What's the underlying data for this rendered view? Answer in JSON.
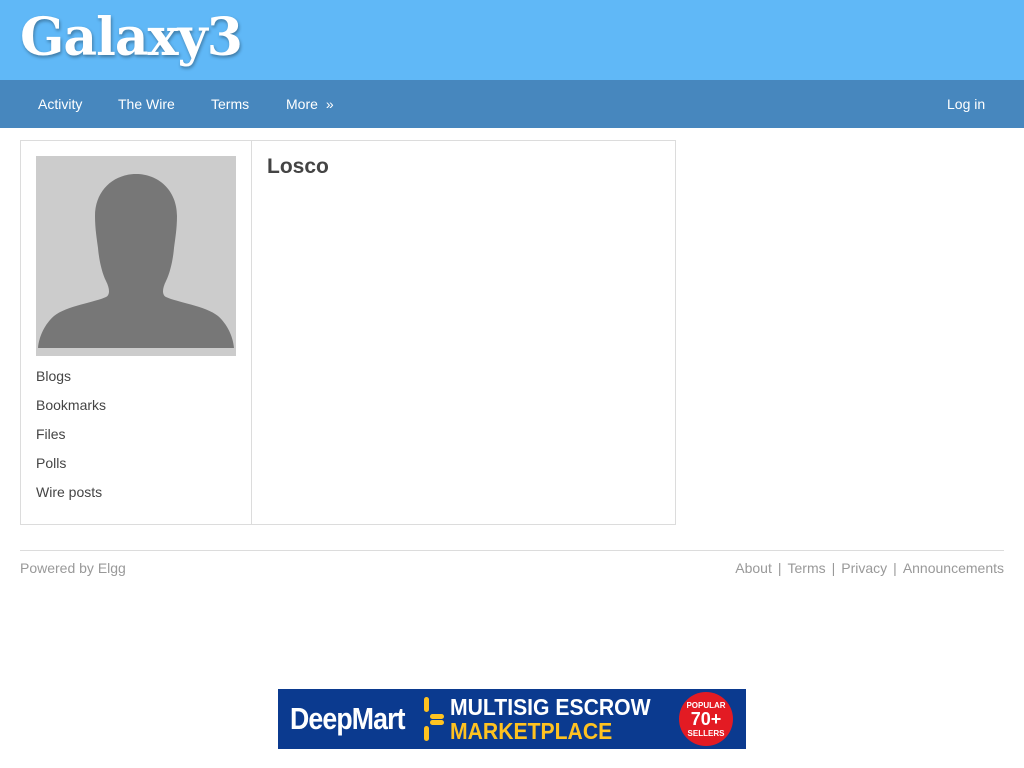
{
  "site": {
    "title": "Galaxy3"
  },
  "nav": {
    "items": [
      {
        "label": "Activity"
      },
      {
        "label": "The Wire"
      },
      {
        "label": "Terms"
      },
      {
        "label": "More"
      }
    ],
    "more_arrow": "»",
    "login": "Log in"
  },
  "profile": {
    "name": "Losco",
    "links": [
      {
        "label": "Blogs"
      },
      {
        "label": "Bookmarks"
      },
      {
        "label": "Files"
      },
      {
        "label": "Polls"
      },
      {
        "label": "Wire posts"
      }
    ]
  },
  "footer": {
    "powered": "Powered by Elgg",
    "links": [
      {
        "label": "About"
      },
      {
        "label": "Terms"
      },
      {
        "label": "Privacy"
      },
      {
        "label": "Announcements"
      }
    ],
    "separator": "|"
  },
  "ad": {
    "brand": "DeepMart",
    "line1": "MULTISIG ESCROW",
    "line2": "MARKETPLACE",
    "badge_top": "POPULAR",
    "badge_number": "70+",
    "badge_bottom": "SELLERS"
  },
  "colors": {
    "header_bg": "#60b8f7",
    "nav_bg": "#4787be",
    "ad_bg": "#0b3a8f",
    "ad_accent": "#ffc220",
    "badge_red": "#e31b23"
  }
}
